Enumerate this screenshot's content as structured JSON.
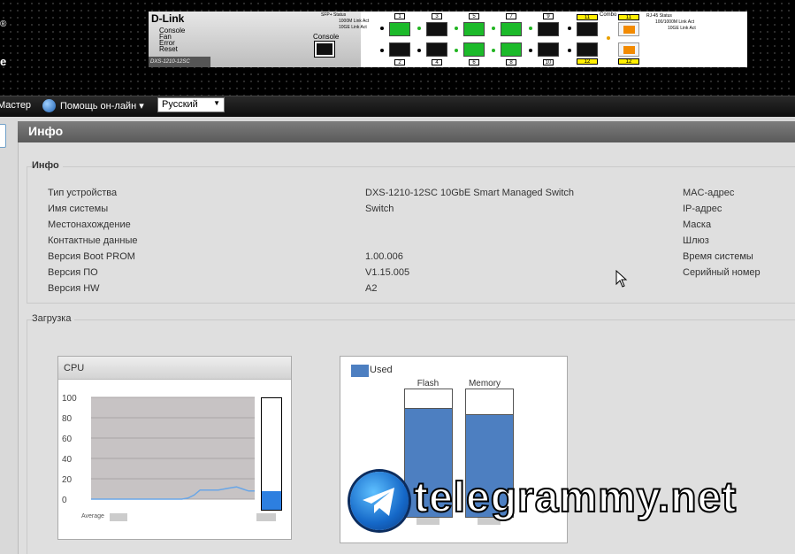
{
  "banner": {
    "brand_reg": "®",
    "brand_letter": "e",
    "logo_text": "D-Link",
    "model": "DXS-1210-12SC",
    "leds": [
      "Console",
      "Fan",
      "Error",
      "Reset"
    ],
    "console_label": "Console",
    "sfp_legend": [
      "SFP+ Status",
      "1000M",
      "Link",
      "Act",
      "10GE",
      "Link",
      "Act"
    ],
    "combo_label": "Combo",
    "rj45_legend": [
      "RJ-45 Status",
      "100/1000M",
      "Link",
      "Act",
      "10GE",
      "Link",
      "Act"
    ],
    "ports_top": [
      "1",
      "3",
      "5",
      "7",
      "9",
      "11",
      "11"
    ],
    "ports_bottom": [
      "2",
      "4",
      "6",
      "8",
      "10",
      "12",
      "12"
    ]
  },
  "menubar": {
    "wizard": "Мастер",
    "help": "Помощь он-лайн",
    "help_arrow": "▾",
    "language": "Русский",
    "language_arrow": "▼"
  },
  "page": {
    "title": "Инфо"
  },
  "info": {
    "legend": "Инфо",
    "left": [
      {
        "label": "Тип устройства",
        "value": "DXS-1210-12SC 10GbE Smart Managed Switch"
      },
      {
        "label": "Имя системы",
        "value": "Switch"
      },
      {
        "label": "Местонахождение",
        "value": ""
      },
      {
        "label": "Контактные данные",
        "value": ""
      },
      {
        "label": "Версия Boot PROM",
        "value": "1.00.006"
      },
      {
        "label": "Версия ПО",
        "value": "V1.15.005"
      },
      {
        "label": "Версия HW",
        "value": "A2"
      }
    ],
    "right": [
      "MAC-адрес",
      "IP-адрес",
      "Маска",
      "Шлюз",
      "Время системы",
      "Серийный номер"
    ]
  },
  "load": {
    "legend": "Загрузка",
    "cpu": {
      "title": "CPU",
      "average_label": "Average",
      "current_percent": 17
    },
    "memory": {
      "legend_label": "Used",
      "flash_label": "Flash",
      "memory_label": "Memory",
      "flash_used_fraction": 0.85,
      "memory_used_fraction": 0.8
    }
  },
  "chart_data": {
    "type": "line",
    "title": "CPU",
    "yticks": [
      100,
      80,
      60,
      40,
      20,
      0
    ],
    "ylim": [
      0,
      100
    ],
    "series": [
      {
        "values": [
          0,
          0,
          0,
          0,
          0,
          0,
          0,
          0,
          0,
          0,
          0,
          0,
          0,
          0,
          0,
          0,
          1,
          4,
          9,
          9,
          9,
          9,
          10,
          11,
          12,
          10,
          8,
          8
        ]
      }
    ],
    "colors": {
      "line": "#6aa6e6",
      "plot_bg": "#c7c3c4"
    }
  },
  "watermark": {
    "text": "telegrammy.net"
  }
}
